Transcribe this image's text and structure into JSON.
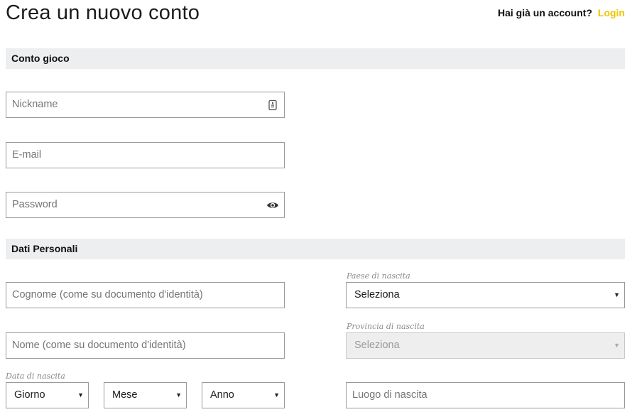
{
  "header": {
    "title": "Crea un nuovo conto",
    "account_question": "Hai già un account?",
    "login_link": "Login"
  },
  "sections": {
    "account": "Conto gioco",
    "personal": "Dati Personali"
  },
  "account_fields": {
    "nickname_placeholder": "Nickname",
    "email_placeholder": "E-mail",
    "password_placeholder": "Password"
  },
  "personal_fields": {
    "surname_placeholder": "Cognome (come su documento d'identità)",
    "name_placeholder": "Nome (come su documento d'identità)",
    "birth_date_label": "Data di nascita",
    "day_select": "Giorno",
    "month_select": "Mese",
    "year_select": "Anno",
    "birth_country_label": "Paese di nascita",
    "birth_country_select": "Seleziona",
    "birth_province_label": "Provincia di nascita",
    "birth_province_select": "Seleziona",
    "birth_place_placeholder": "Luogo di nascita"
  },
  "colors": {
    "accent": "#f2c200",
    "section_bg": "#eceef0",
    "border": "#9a9a9a"
  },
  "icons": {
    "nickname": "id-card-icon",
    "password": "eye-icon",
    "select": "caret-down-icon"
  }
}
